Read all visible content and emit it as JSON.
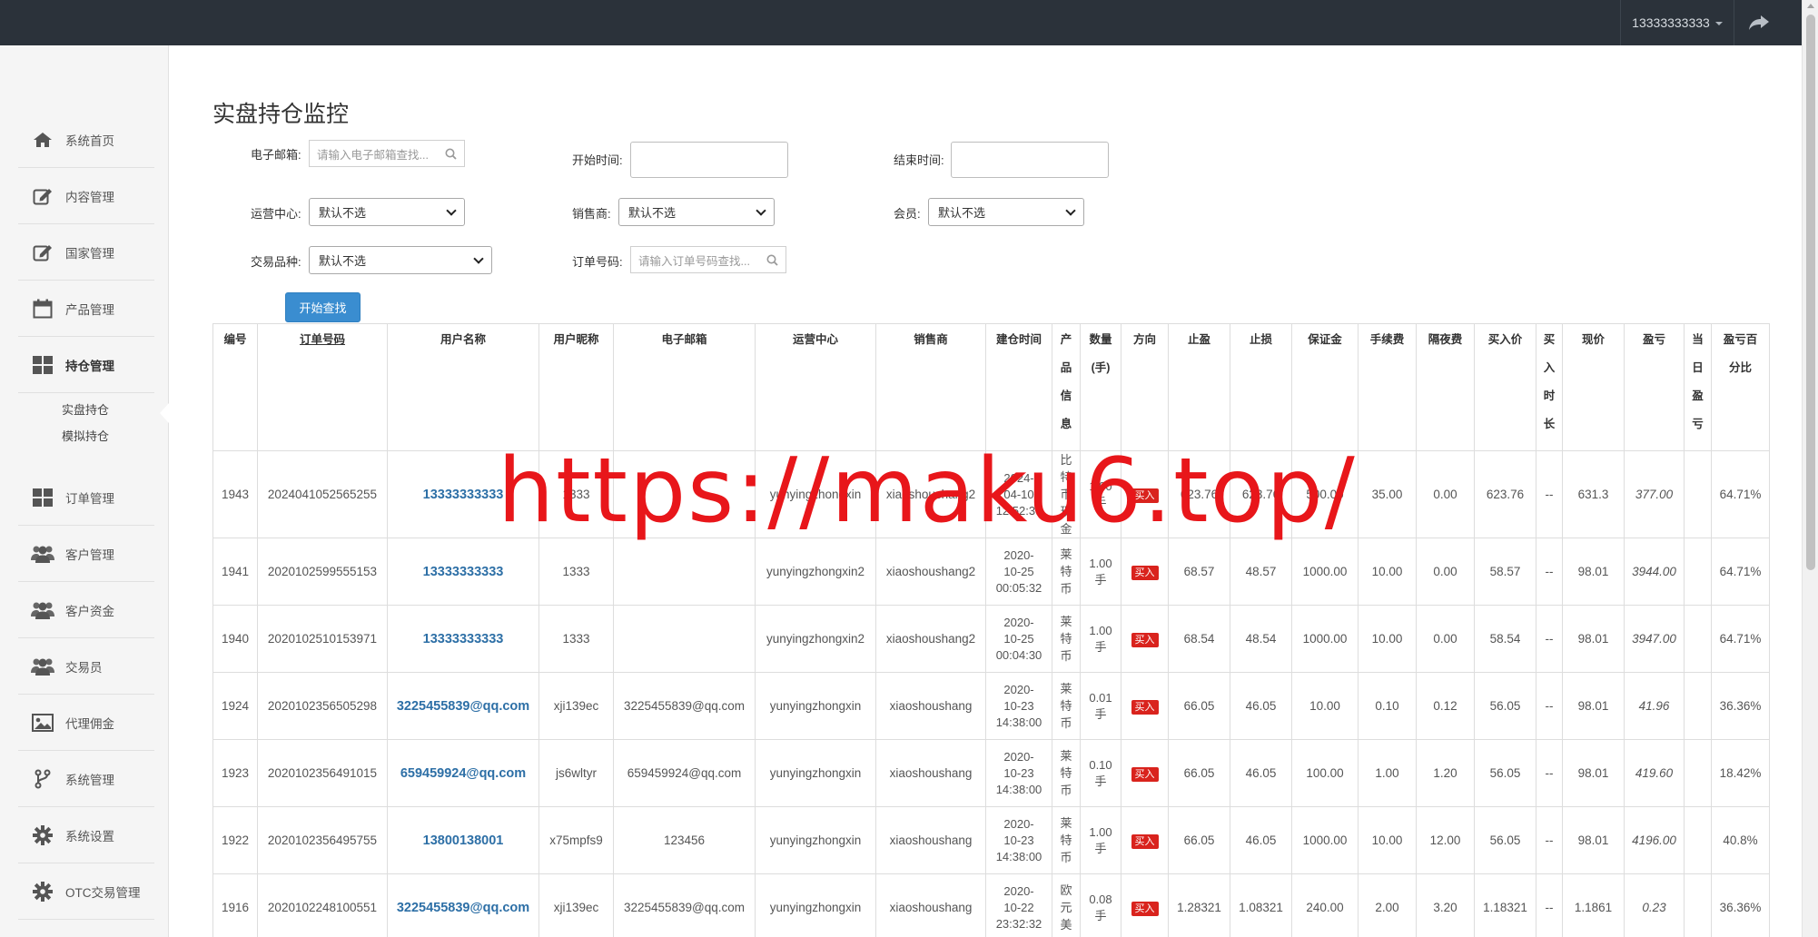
{
  "header": {
    "user": "13333333333"
  },
  "sidebar": {
    "items": [
      {
        "label": "系统首页",
        "icon": "home-icon"
      },
      {
        "label": "内容管理",
        "icon": "edit-icon"
      },
      {
        "label": "国家管理",
        "icon": "edit-icon"
      },
      {
        "label": "产品管理",
        "icon": "calendar-icon"
      },
      {
        "label": "持仓管理",
        "icon": "grid-icon",
        "active": true
      },
      {
        "label": "订单管理",
        "icon": "grid-icon"
      },
      {
        "label": "客户管理",
        "icon": "users-icon"
      },
      {
        "label": "客户资金",
        "icon": "users-icon"
      },
      {
        "label": "交易员",
        "icon": "users-icon"
      },
      {
        "label": "代理佣金",
        "icon": "image-icon"
      },
      {
        "label": "系统管理",
        "icon": "branch-icon"
      },
      {
        "label": "系统设置",
        "icon": "gear-icon"
      },
      {
        "label": "OTC交易管理",
        "icon": "gear-icon"
      }
    ],
    "subitems": [
      "实盘持仓",
      "模拟持仓"
    ]
  },
  "page": {
    "title": "实盘持仓监控"
  },
  "filters": {
    "email_label": "电子邮箱:",
    "email_placeholder": "请输入电子邮箱查找...",
    "start_label": "开始时间:",
    "end_label": "结束时间:",
    "ops_label": "运营中心:",
    "ops_value": "默认不选",
    "sales_label": "销售商:",
    "sales_value": "默认不选",
    "member_label": "会员:",
    "member_value": "默认不选",
    "product_label": "交易品种:",
    "product_value": "默认不选",
    "order_label": "订单号码:",
    "order_placeholder": "请输入订单号码查找...",
    "search_button": "开始查找"
  },
  "table": {
    "headers": [
      "编号",
      "订单号码",
      "用户名称",
      "用户昵称",
      "电子邮箱",
      "运营中心",
      "销售商",
      "建仓时间",
      "产品信息",
      "数量(手)",
      "方向",
      "止盈",
      "止损",
      "保证金",
      "手续费",
      "隔夜费",
      "买入价",
      "买入时长",
      "现价",
      "盈亏",
      "当日盈亏",
      "盈亏百分比"
    ],
    "rows": [
      {
        "id": "1943",
        "order": "2024041052565255",
        "user": "13333333333",
        "nick": "1333",
        "email": "",
        "ops": "yunyingzhongxin",
        "sales": "xiaoshoushang2",
        "time1": "2024-",
        "time2": "04-10",
        "time3": "12:52:36",
        "product": "比特币现金",
        "qty1": "1.00",
        "qty2": "手",
        "dir": "买入",
        "tp": "623.76",
        "sl": "623.76",
        "margin": "500.00",
        "fee": "35.00",
        "overnight": "0.00",
        "buy": "623.76",
        "dur": "--",
        "price": "631.3",
        "pnl": "377.00",
        "today": "",
        "pct": "64.71%"
      },
      {
        "id": "1941",
        "order": "2020102599555153",
        "user": "13333333333",
        "nick": "1333",
        "email": "",
        "ops": "yunyingzhongxin2",
        "sales": "xiaoshoushang2",
        "time1": "2020-",
        "time2": "10-25",
        "time3": "00:05:32",
        "product": "莱特币",
        "qty1": "1.00",
        "qty2": "手",
        "dir": "买入",
        "tp": "68.57",
        "sl": "48.57",
        "margin": "1000.00",
        "fee": "10.00",
        "overnight": "0.00",
        "buy": "58.57",
        "dur": "--",
        "price": "98.01",
        "pnl": "3944.00",
        "today": "",
        "pct": "64.71%"
      },
      {
        "id": "1940",
        "order": "2020102510153971",
        "user": "13333333333",
        "nick": "1333",
        "email": "",
        "ops": "yunyingzhongxin2",
        "sales": "xiaoshoushang2",
        "time1": "2020-",
        "time2": "10-25",
        "time3": "00:04:30",
        "product": "莱特币",
        "qty1": "1.00",
        "qty2": "手",
        "dir": "买入",
        "tp": "68.54",
        "sl": "48.54",
        "margin": "1000.00",
        "fee": "10.00",
        "overnight": "0.00",
        "buy": "58.54",
        "dur": "--",
        "price": "98.01",
        "pnl": "3947.00",
        "today": "",
        "pct": "64.71%"
      },
      {
        "id": "1924",
        "order": "2020102356505298",
        "user": "3225455839@qq.com",
        "nick": "xji139ec",
        "email": "3225455839@qq.com",
        "ops": "yunyingzhongxin",
        "sales": "xiaoshoushang",
        "time1": "2020-",
        "time2": "10-23",
        "time3": "14:38:00",
        "product": "莱特币",
        "qty1": "0.01",
        "qty2": "手",
        "dir": "买入",
        "tp": "66.05",
        "sl": "46.05",
        "margin": "10.00",
        "fee": "0.10",
        "overnight": "0.12",
        "buy": "56.05",
        "dur": "--",
        "price": "98.01",
        "pnl": "41.96",
        "today": "",
        "pct": "36.36%"
      },
      {
        "id": "1923",
        "order": "2020102356491015",
        "user": "659459924@qq.com",
        "nick": "js6wltyr",
        "email": "659459924@qq.com",
        "ops": "yunyingzhongxin",
        "sales": "xiaoshoushang",
        "time1": "2020-",
        "time2": "10-23",
        "time3": "14:38:00",
        "product": "莱特币",
        "qty1": "0.10",
        "qty2": "手",
        "dir": "买入",
        "tp": "66.05",
        "sl": "46.05",
        "margin": "100.00",
        "fee": "1.00",
        "overnight": "1.20",
        "buy": "56.05",
        "dur": "--",
        "price": "98.01",
        "pnl": "419.60",
        "today": "",
        "pct": "18.42%"
      },
      {
        "id": "1922",
        "order": "2020102356495755",
        "user": "13800138001",
        "nick": "x75mpfs9",
        "email": "123456",
        "ops": "yunyingzhongxin",
        "sales": "xiaoshoushang",
        "time1": "2020-",
        "time2": "10-23",
        "time3": "14:38:00",
        "product": "莱特币",
        "qty1": "1.00",
        "qty2": "手",
        "dir": "买入",
        "tp": "66.05",
        "sl": "46.05",
        "margin": "1000.00",
        "fee": "10.00",
        "overnight": "12.00",
        "buy": "56.05",
        "dur": "--",
        "price": "98.01",
        "pnl": "4196.00",
        "today": "",
        "pct": "40.8%"
      },
      {
        "id": "1916",
        "order": "2020102248100551",
        "user": "3225455839@qq.com",
        "nick": "xji139ec",
        "email": "3225455839@qq.com",
        "ops": "yunyingzhongxin",
        "sales": "xiaoshoushang",
        "time1": "2020-",
        "time2": "10-22",
        "time3": "23:32:32",
        "product": "欧元美",
        "qty1": "0.08",
        "qty2": "手",
        "dir": "买入",
        "tp": "1.28321",
        "sl": "1.08321",
        "margin": "240.00",
        "fee": "2.00",
        "overnight": "3.20",
        "buy": "1.18321",
        "dur": "--",
        "price": "1.1861",
        "pnl": "0.23",
        "today": "",
        "pct": "36.36%"
      }
    ]
  },
  "watermark": "https://maku6.top/",
  "colors": {
    "topbar": "#2b323a",
    "link": "#2d6fa6",
    "buy_badge": "#d9231d",
    "button": "#3a8dd0",
    "watermark": "#e8161a"
  }
}
